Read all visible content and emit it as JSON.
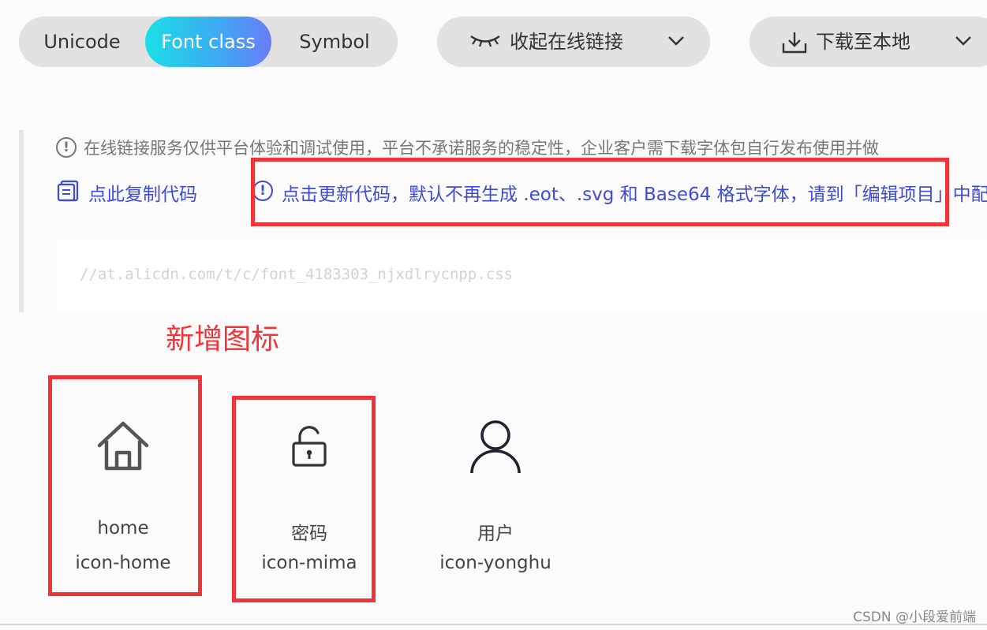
{
  "tabs": {
    "unicode": "Unicode",
    "font_class": "Font class",
    "symbol": "Symbol"
  },
  "toolbar": {
    "collapse_label": "收起在线链接",
    "download_label": "下载至本地"
  },
  "notice": {
    "text": "在线链接服务仅供平台体验和调试使用，平台不承诺服务的稳定性，企业客户需下载字体包自行发布使用并做"
  },
  "actions": {
    "copy_label": "点此复制代码",
    "update_label": "点击更新代码，默认不再生成 .eot、.svg 和 Base64 格式字体，请到「编辑项目」中配"
  },
  "code": {
    "url": "//at.alicdn.com/t/c/font_4183303_njxdlrycnpp.css"
  },
  "annotation": {
    "text": "新增图标"
  },
  "icons": [
    {
      "name": "home",
      "class": "icon-home",
      "icon": "home-icon"
    },
    {
      "name": "密码",
      "class": "icon-mima",
      "icon": "lock-icon"
    },
    {
      "name": "用户",
      "class": "icon-yonghu",
      "icon": "user-icon"
    }
  ],
  "watermark": {
    "text": "CSDN @小段爱前端"
  },
  "colors": {
    "accent_gradient_start": "#1bdfe6",
    "accent_gradient_end": "#6b7cf7",
    "link_blue": "#3f4bd6",
    "annotation_red": "#f0353a"
  }
}
